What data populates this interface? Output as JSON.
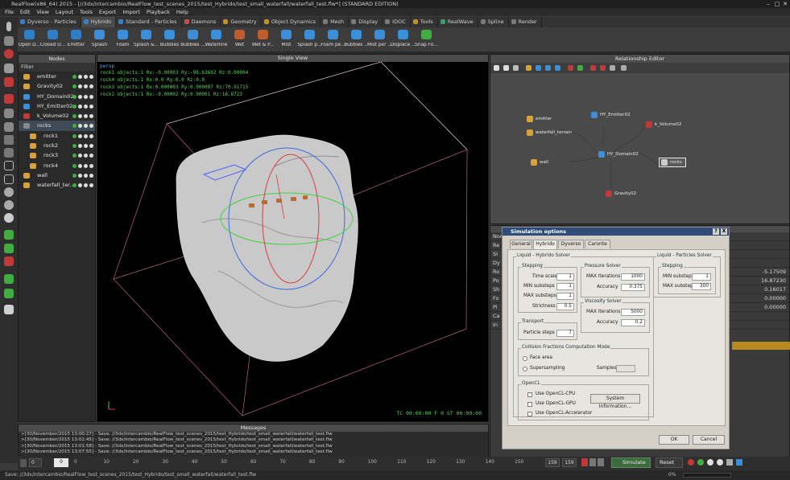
{
  "window": {
    "title": "RealFlow(x86_64) 2015 - [//3dx/intercambio/RealFlow_test_scenes_2015/test_Hybrido/test_small_waterfall/waterfall_test.flw*] (STANDARD EDITION)"
  },
  "menu": [
    "File",
    "Edit",
    "View",
    "Layout",
    "Tools",
    "Export",
    "Import",
    "Playback",
    "Help"
  ],
  "tabs": [
    {
      "label": "Dyverso - Particles",
      "color": "#3b7fbf"
    },
    {
      "label": "Hybrido",
      "color": "#3b7fbf"
    },
    {
      "label": "Standard - Particles",
      "color": "#3b7fbf"
    },
    {
      "label": "Daemons",
      "color": "#c05050"
    },
    {
      "label": "Geometry",
      "color": "#c0902f"
    },
    {
      "label": "Object Dynamics",
      "color": "#c0902f"
    },
    {
      "label": "Mesh",
      "color": "#7a7a7a"
    },
    {
      "label": "Display",
      "color": "#7a7a7a"
    },
    {
      "label": "IDOC",
      "color": "#7a7a7a"
    },
    {
      "label": "Tools",
      "color": "#c0902f"
    },
    {
      "label": "RealWave",
      "color": "#3b9f6f"
    },
    {
      "label": "Spline",
      "color": "#7a7a7a"
    },
    {
      "label": "Render",
      "color": "#7a7a7a"
    }
  ],
  "active_tab": "Hybrido",
  "tools": [
    {
      "label": "Open D...",
      "color": "#2f7fc7"
    },
    {
      "label": "Closed D...",
      "color": "#2f7fc7"
    },
    {
      "label": "Emitter",
      "color": "#2f7fc7"
    },
    {
      "label": "Splash",
      "color": "#3a8fd8"
    },
    {
      "label": "Foam",
      "color": "#3a8fd8"
    },
    {
      "label": "Splash &...",
      "color": "#3a8fd8"
    },
    {
      "label": "Bubbles",
      "color": "#3a8fd8"
    },
    {
      "label": "Bubbles ...",
      "color": "#3a8fd8"
    },
    {
      "label": "Waterline",
      "color": "#3a8fd8"
    },
    {
      "label": "Wet",
      "color": "#c05a2f"
    },
    {
      "label": "Wet & P...",
      "color": "#c05a2f"
    },
    {
      "label": "Mist",
      "color": "#3a8fd8"
    },
    {
      "label": "Splash p...",
      "color": "#3a8fd8"
    },
    {
      "label": "Foam pe...",
      "color": "#3a8fd8"
    },
    {
      "label": "Bubbles ...",
      "color": "#3a8fd8"
    },
    {
      "label": "Mist per ...",
      "color": "#3a8fd8"
    },
    {
      "label": "Displace ...",
      "color": "#3a8fd8"
    },
    {
      "label": "Snap Fo...",
      "color": "#3fae3f"
    }
  ],
  "nodes_panel": {
    "title": "Nodes",
    "filter_label": "Filter",
    "items": [
      {
        "label": "emitter",
        "color": "#d9a13a",
        "indent": 0
      },
      {
        "label": "Gravity02",
        "color": "#d9a13a",
        "indent": 0
      },
      {
        "label": "HY_Domain02",
        "color": "#3a8fd8",
        "indent": 0
      },
      {
        "label": "HY_Emitter02",
        "color": "#3a8fd8",
        "indent": 0
      },
      {
        "label": "k_Volume02",
        "color": "#c0393b",
        "indent": 0
      },
      {
        "label": "rocks",
        "color": "#888888",
        "indent": 0,
        "selected": true
      },
      {
        "label": "rock1",
        "color": "#d9a13a",
        "indent": 1
      },
      {
        "label": "rock2",
        "color": "#d9a13a",
        "indent": 1
      },
      {
        "label": "rock3",
        "color": "#d9a13a",
        "indent": 1
      },
      {
        "label": "rock4",
        "color": "#d9a13a",
        "indent": 1
      },
      {
        "label": "wall",
        "color": "#d9a13a",
        "indent": 0
      },
      {
        "label": "waterfall_ter...",
        "color": "#d9a13a",
        "indent": 0
      }
    ]
  },
  "viewport": {
    "title": "Single View",
    "camera": "persp",
    "info": [
      "rock1 objects:1 Rx:-0.00003 Ry:-98.63692 Rz:0.00004",
      "rock4 objects:1 Rx:0.0 Ry:0.0 Rz:0.0",
      "rock3 objects:1 Rx:0.000003 Ry:0.000007 Rz:70.91715",
      "rock2 objects:1 Rx:-0.00002 Ry:0.00001 Rz:16.8723"
    ],
    "timecode": "TC 00:00:00    F 0    ST 00:00:00"
  },
  "relationship_editor": {
    "title": "Relationship Editor",
    "graph_nodes": [
      {
        "label": "emitter",
        "color": "#d9a13a"
      },
      {
        "label": "waterfall_terrain",
        "color": "#d9a13a"
      },
      {
        "label": "HY_Emitter02",
        "color": "#3a8fd8"
      },
      {
        "label": "k_Volume02",
        "color": "#c0393b"
      },
      {
        "label": "HY_Domain02",
        "color": "#3a8fd8"
      },
      {
        "label": "wall",
        "color": "#d9a13a"
      },
      {
        "label": "rocks",
        "color": "#cccccc"
      },
      {
        "label": "Gravity02",
        "color": "#c0393b"
      }
    ]
  },
  "properties_values": [
    "-5.17509",
    "16.87230",
    "0.16017",
    "0.00000",
    "0.00000"
  ],
  "properties_rows": [
    "Nod",
    "Re",
    "SI",
    "Dy",
    "Ro",
    "Po",
    "Sh",
    "Fo",
    "Pi",
    "Ca",
    "In"
  ],
  "messages": {
    "title": "Messages",
    "lines": [
      ">[30/November/2015 13:00:27] - Save: //3dx/intercambio/RealFlow_test_scenes_2015/test_Hybrido/test_small_waterfall/waterfall_test.flw",
      ">[30/November/2015 13:01:45] - Save: //3dx/intercambio/RealFlow_test_scenes_2015/test_Hybrido/test_small_waterfall/waterfall_test.flw",
      ">[30/November/2015 13:01:58] - Save: //3dx/intercambio/RealFlow_test_scenes_2015/test_Hybrido/test_small_waterfall/waterfall_test.flw",
      ">[30/November/2015 13:07:55] - Save: //3dx/intercambio/RealFlow_test_scenes_2015/test_Hybrido/test_small_waterfall/waterfall_test.flw"
    ]
  },
  "timeline": {
    "start": "0",
    "current": "0",
    "ticks": [
      "0",
      "10",
      "20",
      "30",
      "40",
      "50",
      "60",
      "70",
      "80",
      "90",
      "100",
      "110",
      "120",
      "130",
      "140",
      "150"
    ],
    "end_a": "159",
    "end_b": "159",
    "simulate_label": "Simulate",
    "reset_label": "Reset",
    "progress": "0%"
  },
  "statusbar": {
    "text": "Save: //3dx/intercambio/RealFlow_test_scenes_2015/test_Hybrido/test_small_waterfall/waterfall_test.flw"
  },
  "dialog": {
    "title": "Simulation options",
    "help": "?",
    "close": "X",
    "tabs": [
      "General",
      "Hybrido",
      "Dyverso",
      "Caronte"
    ],
    "active_tab": "Hybrido",
    "liquid_hybrido": "Liquid - Hybrido Solver",
    "liquid_particles": "Liquid - Particles Solver",
    "stepping": "Stepping",
    "time_scale_label": "Time scale",
    "time_scale": "1",
    "min_substeps_label": "MIN substeps",
    "min_substeps": "1",
    "max_substeps_label": "MAX substeps",
    "max_substeps": "1",
    "strictness_label": "Strictness",
    "strictness": "0.5",
    "pressure": "Pressure Solver",
    "p_max_iter_label": "MAX iterations",
    "p_max_iter": "1000",
    "p_accuracy_label": "Accuracy",
    "p_accuracy": "0.375",
    "viscosity": "Viscosity Solver",
    "v_max_iter_label": "MAX iterations",
    "v_max_iter": "5000",
    "v_accuracy_label": "Accuracy",
    "v_accuracy": "0.2",
    "transport": "Transport",
    "particle_steps_label": "Particle steps",
    "particle_steps": "7",
    "collision": "Collision Fractions Computation Mode",
    "face_area": "Face area",
    "supersampling": "Supersampling",
    "samples_label": "Samples",
    "samples": "",
    "opencl": "OpenCL",
    "cpu": "Use OpenCL-CPU",
    "gpu": "Use OpenCL-GPU",
    "acc": "Use OpenCL-Accelerator",
    "sysinfo": "System Information...",
    "lp_stepping": "Stepping",
    "lp_min_label": "MIN substeps",
    "lp_min": "1",
    "lp_max_label": "MAX substeps",
    "lp_max": "300",
    "ok": "OK",
    "cancel": "Cancel"
  }
}
